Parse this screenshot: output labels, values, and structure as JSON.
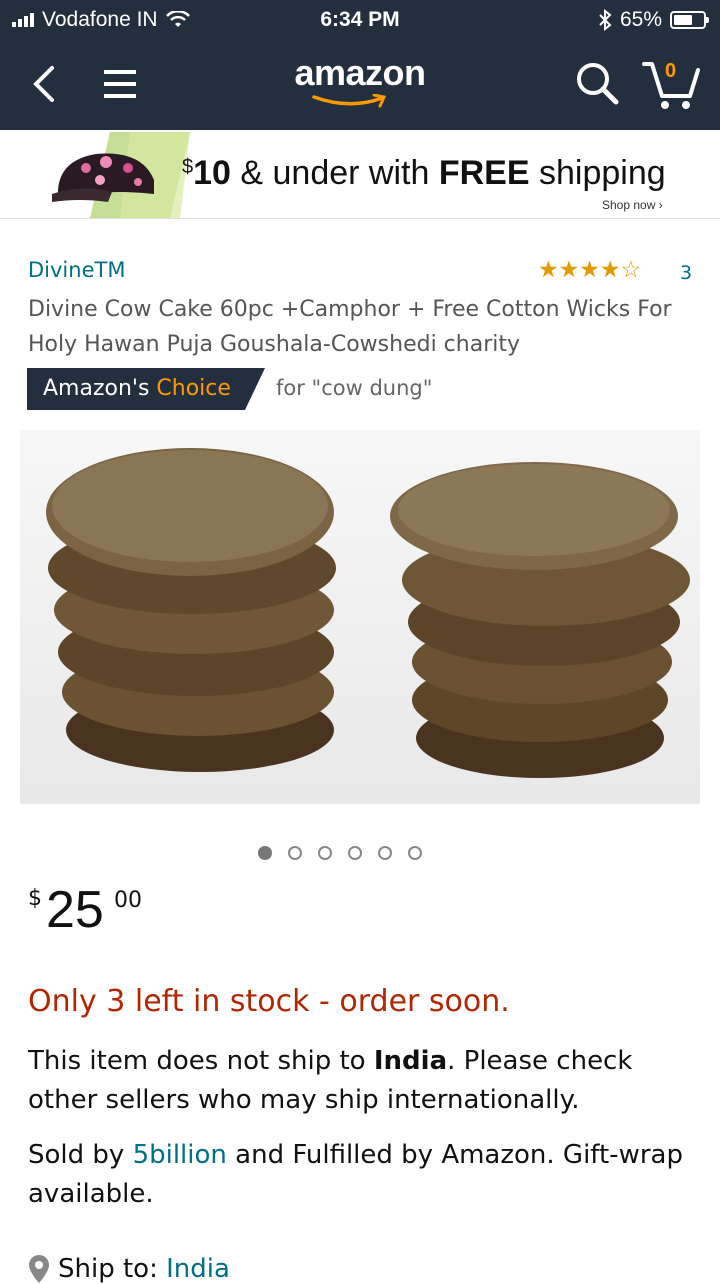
{
  "status_bar": {
    "carrier": "Vodafone IN",
    "time": "6:34 PM",
    "battery": "65%",
    "battery_level": 0.65
  },
  "nav": {
    "logo": "amazon",
    "cart_count": "0",
    "icons": [
      "back-chevron-icon",
      "hamburger-menu-icon",
      "search-icon",
      "cart-icon"
    ]
  },
  "banner": {
    "currency": "$",
    "amount": "10",
    "middle": " & under with ",
    "bold": "FREE",
    "end": " shipping",
    "cta": "Shop now ›"
  },
  "product": {
    "brand": "DivineTM",
    "rating_stars": 4.5,
    "rating_count": "3",
    "title": "Divine Cow Cake 60pc +Camphor + Free Cotton Wicks For Holy Hawan Puja Goushala-Cowshedi charity",
    "badge_prefix": "Amazon's ",
    "badge_highlight": "Choice",
    "badge_for": "for \"cow dung\"",
    "image_count": 6,
    "image_active_index": 0
  },
  "price": {
    "currency": "$",
    "whole": "25",
    "fraction": "00"
  },
  "stock": "Only 3 left in stock - order soon.",
  "shipping": {
    "prefix": "This item does not ship to ",
    "country": "India",
    "suffix": ". Please check other sellers who may ship internationally."
  },
  "seller": {
    "prefix": "Sold by ",
    "name": "5billion",
    "suffix": " and Fulfilled by Amazon. Gift-wrap available."
  },
  "ship_to": {
    "label": "Ship to: ",
    "country": "India"
  },
  "colors": {
    "nav_bg": "#232f3e",
    "accent_orange": "#ff9900",
    "link_teal": "#007185",
    "stock_red": "#b12704"
  }
}
